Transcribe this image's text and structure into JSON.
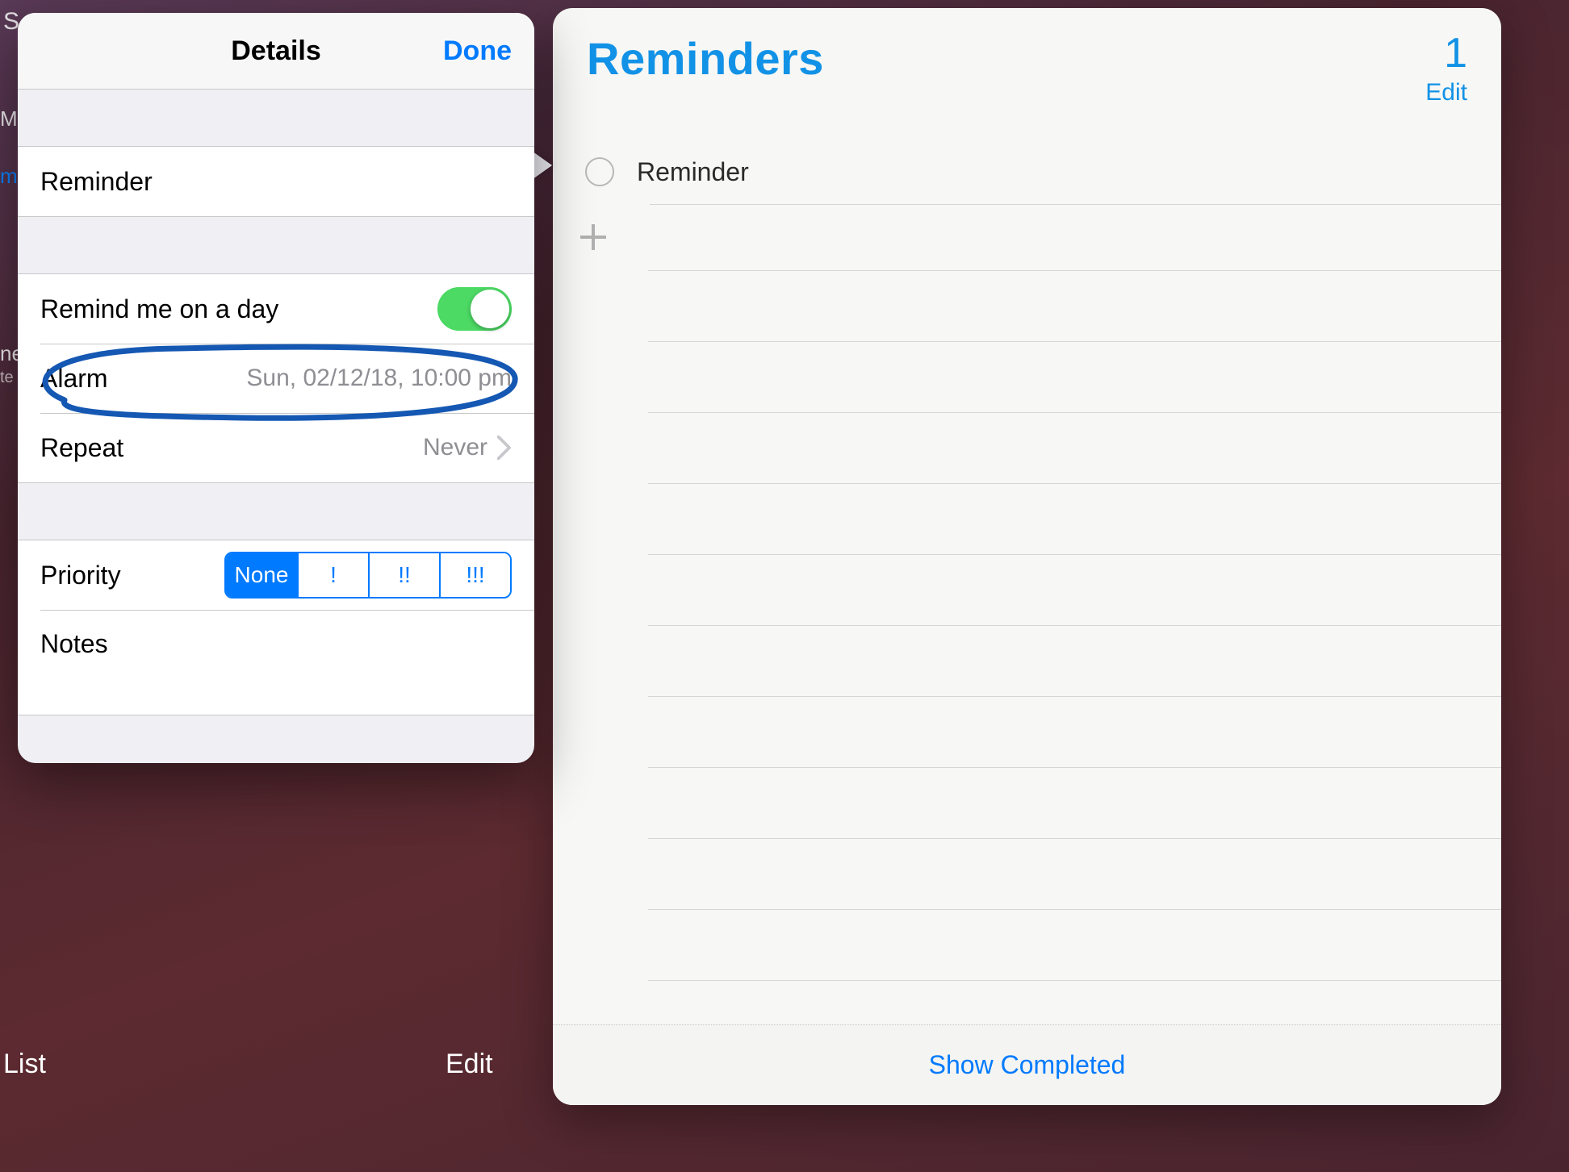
{
  "background": {
    "search_fragment": "S",
    "sidebar_fragment_1": "M",
    "sidebar_fragment_2": "ne",
    "sidebar_fragment_3": "te",
    "sidebar_fragment_blue": "m",
    "bottom_left": "  List",
    "bottom_edit": "Edit"
  },
  "details": {
    "header_title": "Details",
    "done_label": "Done",
    "reminder_title": "Reminder",
    "remind_day_label": "Remind me on a day",
    "remind_day_on": true,
    "alarm_label": "Alarm",
    "alarm_value": "Sun, 02/12/18, 10:00 pm",
    "repeat_label": "Repeat",
    "repeat_value": "Never",
    "priority_label": "Priority",
    "priority_options": {
      "none": "None",
      "one": "!",
      "two": "!!",
      "three": "!!!"
    },
    "priority_selected": "none",
    "notes_label": "Notes"
  },
  "reminders": {
    "title": "Reminders",
    "count": "1",
    "edit_label": "Edit",
    "items": [
      {
        "text": "Reminder",
        "completed": false
      }
    ],
    "footer_show_completed": "Show Completed"
  },
  "colors": {
    "ios_blue": "#007aff",
    "reminders_blue": "#1292e6",
    "toggle_green": "#4cd964"
  }
}
